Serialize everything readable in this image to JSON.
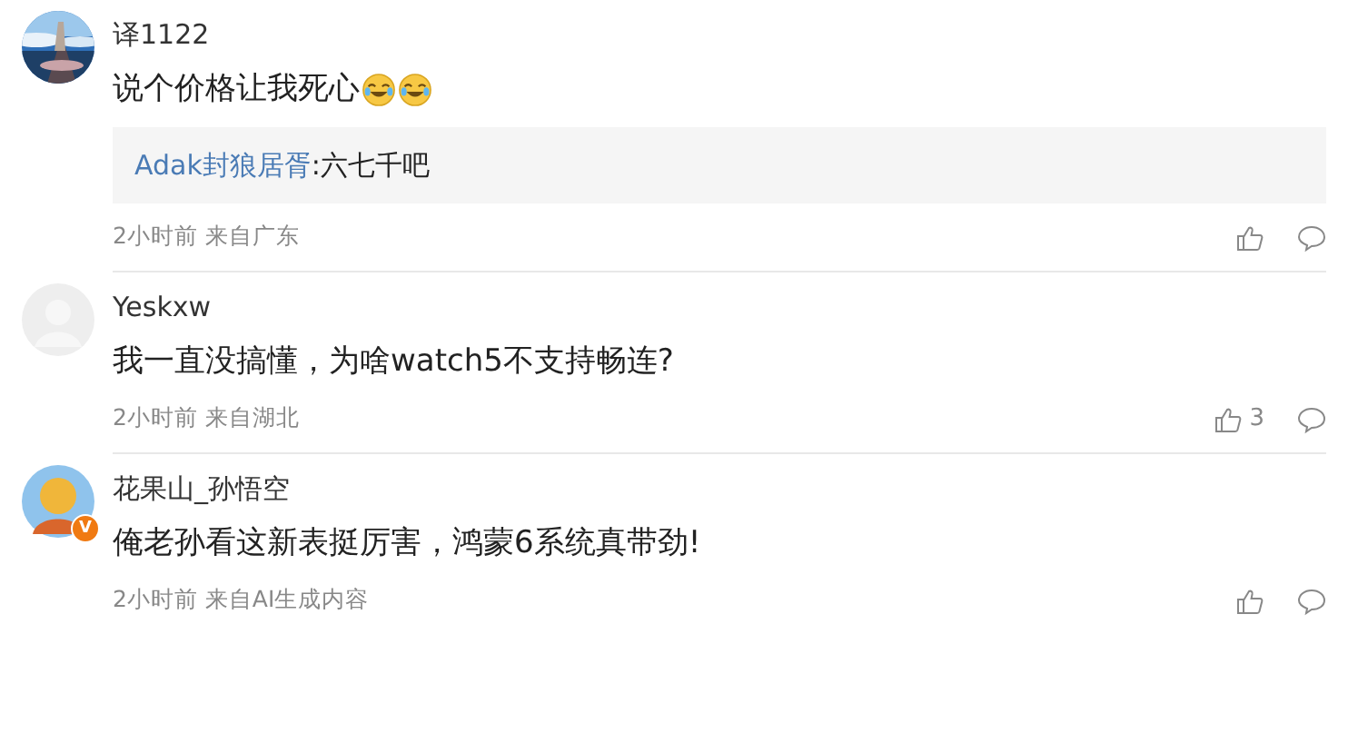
{
  "comments": [
    {
      "name": "译1122",
      "content": [
        {
          "kind": "text",
          "text": "说个价格让我死心"
        },
        {
          "kind": "emoji"
        },
        {
          "kind": "emoji"
        }
      ],
      "reply": {
        "author": "Adak封狼居胥",
        "text": ":六七千吧"
      },
      "meta": "2小时前 来自广东"
    },
    {
      "avatar": {
        "kind": "blank"
      },
      "name": "Yeskxw",
      "content": [
        {
          "kind": "text",
          "text": "我一直没搞懂，为啥watch5不支持畅连?"
        }
      ],
      "meta": "2小时前 来自湖北",
      "likes": "3"
    },
    {
      "avatar": {
        "kind": "figure",
        "badge": "V"
      },
      "name": "花果山_孙悟空",
      "content": [
        {
          "kind": "text",
          "text": "俺老孙看这新表挺厉害，鸿蒙6系统真带劲!"
        }
      ],
      "meta": "2小时前 来自AI生成内容"
    }
  ]
}
